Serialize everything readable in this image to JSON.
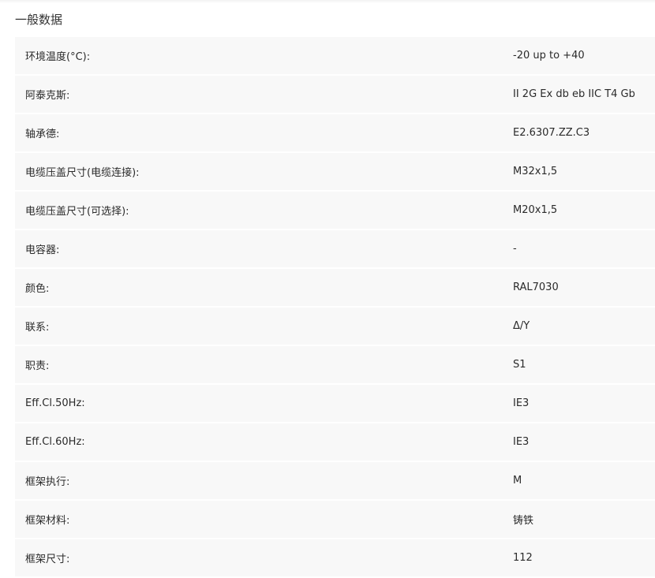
{
  "section": {
    "title": "一般数据"
  },
  "rows": [
    {
      "label": "环境温度(°C):",
      "value": "-20 up to +40"
    },
    {
      "label": "阿泰克斯:",
      "value": "II 2G Ex db eb IIC T4 Gb"
    },
    {
      "label": "轴承德:",
      "value": "E2.6307.ZZ.C3"
    },
    {
      "label": "电缆压盖尺寸(电缆连接):",
      "value": "M32x1,5"
    },
    {
      "label": "电缆压盖尺寸(可选择):",
      "value": "M20x1,5"
    },
    {
      "label": "电容器:",
      "value": "-"
    },
    {
      "label": "颜色:",
      "value": "RAL7030"
    },
    {
      "label": "联系:",
      "value": "Δ/Y"
    },
    {
      "label": "职责:",
      "value": "S1"
    },
    {
      "label": "Eff.Cl.50Hz:",
      "value": "IE3"
    },
    {
      "label": "Eff.Cl.60Hz:",
      "value": "IE3"
    },
    {
      "label": "框架执行:",
      "value": "M"
    },
    {
      "label": "框架材料:",
      "value": "铸铁"
    },
    {
      "label": "框架尺寸:",
      "value": "112"
    }
  ]
}
